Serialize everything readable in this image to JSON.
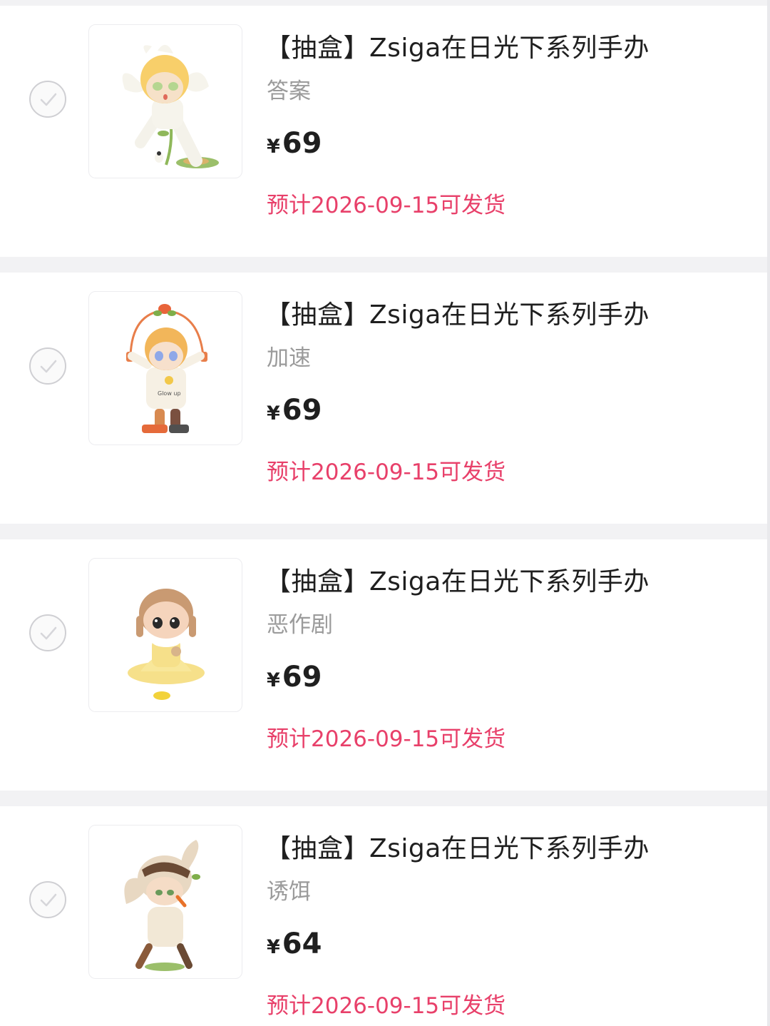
{
  "items": [
    {
      "title": "【抽盒】Zsiga在日光下系列手办",
      "variant": "答案",
      "currency": "¥",
      "price": "69",
      "shipping": "预计2026-09-15可发货",
      "checked": false,
      "image_icon": "figure-daisy-icon"
    },
    {
      "title": "【抽盒】Zsiga在日光下系列手办",
      "variant": "加速",
      "currency": "¥",
      "price": "69",
      "shipping": "预计2026-09-15可发货",
      "checked": false,
      "image_icon": "figure-jumprope-icon"
    },
    {
      "title": "【抽盒】Zsiga在日光下系列手办",
      "variant": "恶作剧",
      "currency": "¥",
      "price": "69",
      "shipping": "预计2026-09-15可发货",
      "checked": false,
      "image_icon": "figure-yellow-dress-icon"
    },
    {
      "title": "【抽盒】Zsiga在日光下系列手办",
      "variant": "诱饵",
      "currency": "¥",
      "price": "64",
      "shipping": "预计2026-09-15可发货",
      "checked": false,
      "image_icon": "figure-bunny-icon"
    }
  ],
  "colors": {
    "background": "#f2f2f4",
    "card": "#ffffff",
    "shipping_text": "#e8406a",
    "variant_text": "#9b9b9b",
    "checkbox_border": "#cfcfd3"
  }
}
